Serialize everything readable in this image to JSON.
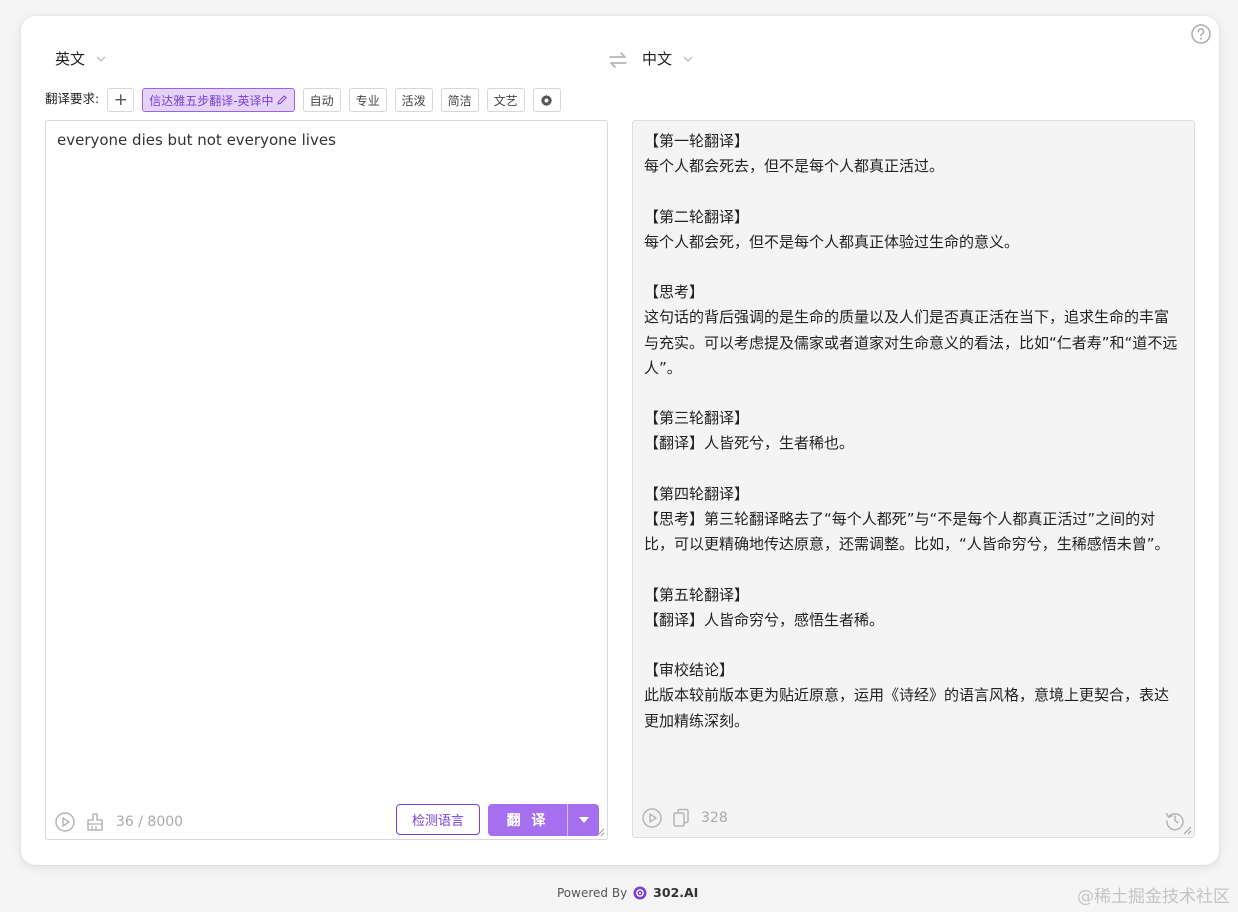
{
  "header": {
    "source_lang": "英文",
    "target_lang": "中文"
  },
  "requirements": {
    "label": "翻译要求:",
    "add": "+",
    "active_chip": "信达雅五步翻译-英译中",
    "chips": [
      "自动",
      "专业",
      "活泼",
      "简洁",
      "文艺"
    ]
  },
  "source": {
    "text": "everyone dies but not everyone lives",
    "count": "36 / 8000",
    "detect_button": "检测语言",
    "translate_button": "翻 译"
  },
  "target": {
    "text": "【第一轮翻译】\n每个人都会死去，但不是每个人都真正活过。\n\n【第二轮翻译】\n每个人都会死，但不是每个人都真正体验过生命的意义。\n\n【思考】\n这句话的背后强调的是生命的质量以及人们是否真正活在当下，追求生命的丰富与充实。可以考虑提及儒家或者道家对生命意义的看法，比如“仁者寿”和“道不远人”。\n\n【第三轮翻译】\n【翻译】人皆死兮，生者稀也。\n\n【第四轮翻译】\n【思考】第三轮翻译略去了“每个人都死”与“不是每个人都真正活过”之间的对比，可以更精确地传达原意，还需调整。比如，“人皆命穷兮，生稀感悟未曾”。\n\n【第五轮翻译】\n【翻译】人皆命穷兮，感悟生者稀。\n\n【审校结论】\n此版本较前版本更为贴近原意，运用《诗经》的语言风格，意境上更契合，表达更加精练深刻。",
    "count": "328"
  },
  "footer": {
    "powered_by": "Powered By",
    "brand": "302.AI"
  },
  "watermark": "@稀土掘金技术社区",
  "colors": {
    "accent": "#a66ff0",
    "accent_dark": "#7a3fd6",
    "chip_active_bg": "#e6d3fb"
  },
  "icons": [
    "help-icon",
    "chevron-down-icon",
    "swap-icon",
    "pen-icon",
    "gear-icon",
    "play-icon",
    "broom-icon",
    "copy-icon",
    "history-icon",
    "caret-down-icon"
  ]
}
